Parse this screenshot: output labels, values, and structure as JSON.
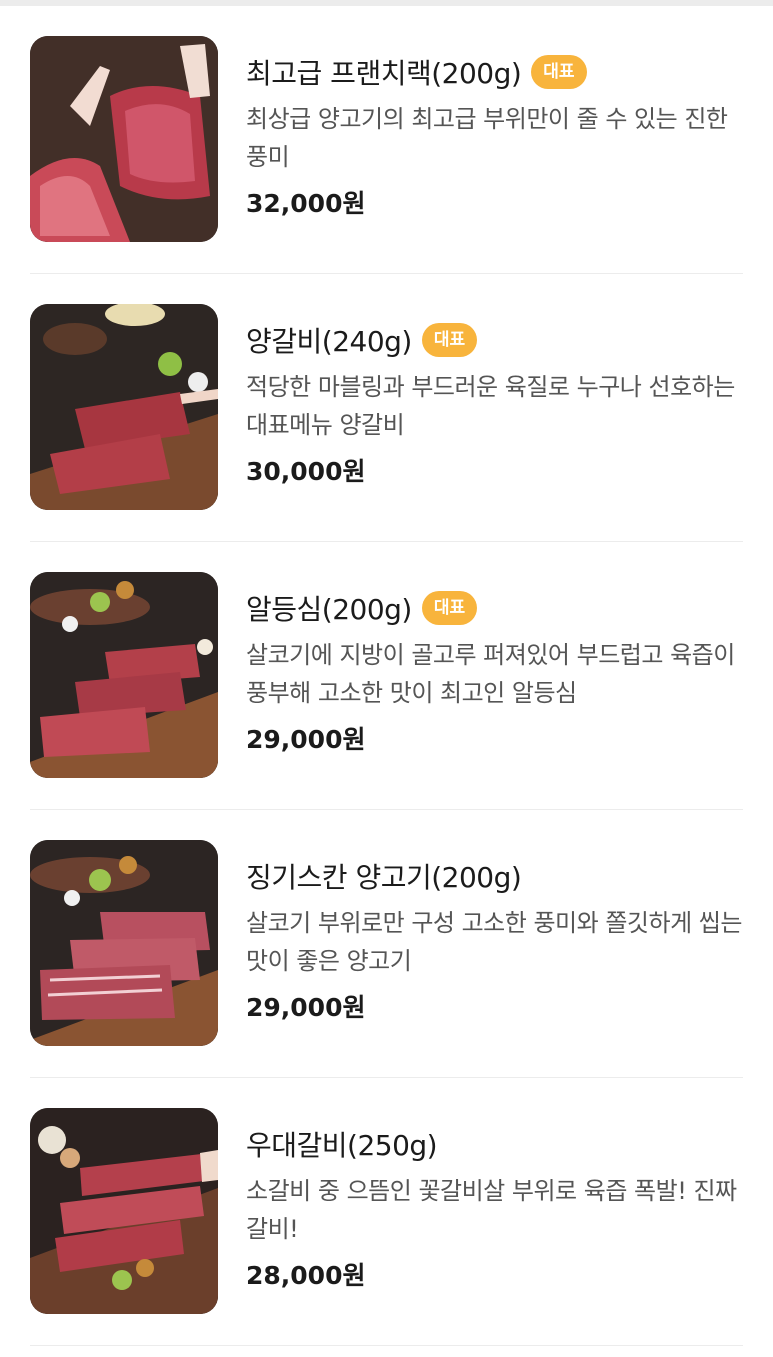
{
  "menu": {
    "items": [
      {
        "name": "최고급 프랜치랙(200g)",
        "badge": "대표",
        "description": "최상급 양고기의 최고급 부위만이 줄 수 있는 진한 풍미",
        "price": "32,000원",
        "image_icon": "lamb-rack-photo"
      },
      {
        "name": "양갈비(240g)",
        "badge": "대표",
        "description": "적당한 마블링과 부드러운 육질로 누구나 선호하는 대표메뉴 양갈비",
        "price": "30,000원",
        "image_icon": "lamb-rib-photo"
      },
      {
        "name": "알등심(200g)",
        "badge": "대표",
        "description": "살코기에 지방이 골고루 퍼져있어 부드럽고 육즙이 풍부해 고소한 맛이 최고인 알등심",
        "price": "29,000원",
        "image_icon": "lamb-loin-photo"
      },
      {
        "name": "징기스칸 양고기(200g)",
        "badge": "",
        "description": "살코기 부위로만 구성 고소한 풍미와 쫄깃하게 씹는 맛이 좋은 양고기",
        "price": "29,000원",
        "image_icon": "lamb-slices-photo"
      },
      {
        "name": "우대갈비(250g)",
        "badge": "",
        "description": "소갈비 중 으뜸인 꽃갈비살 부위로 육즙 폭발! 진짜갈비!",
        "price": "28,000원",
        "image_icon": "beef-short-rib-photo"
      }
    ]
  },
  "colors": {
    "badge": "#f8b43c",
    "divider": "#ececec",
    "text_primary": "#1b1b1b",
    "text_secondary": "#555555"
  }
}
